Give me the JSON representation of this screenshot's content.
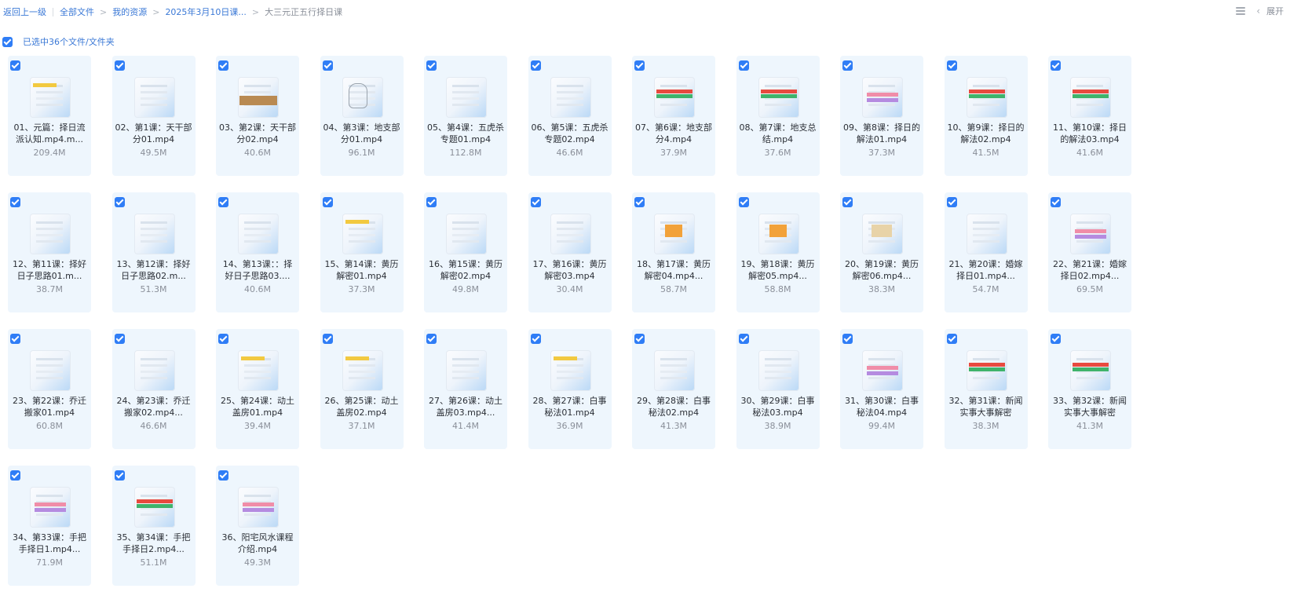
{
  "breadcrumb": {
    "back": "返回上一级",
    "all_files": "全部文件",
    "my_resources": "我的资源",
    "folder": "2025年3月10日课...",
    "current": "大三元正五行择日课"
  },
  "toolbar": {
    "expand": "展开"
  },
  "selection": {
    "text": "已选中36个文件/文件夹"
  },
  "colors": {
    "accent": "#2f7df6",
    "link": "#3a78d6",
    "card_bg": "#eef6fd"
  },
  "files": [
    {
      "name": "01、元篇：择日流派认知.mp4.m...",
      "size": "209.4M",
      "thumb": "yel"
    },
    {
      "name": "02、第1课：天干部分01.mp4",
      "size": "49.5M",
      "thumb": ""
    },
    {
      "name": "03、第2课：天干部分02.mp4",
      "size": "40.6M",
      "thumb": "tan"
    },
    {
      "name": "04、第3课：地支部分01.mp4",
      "size": "96.1M",
      "thumb": "hand"
    },
    {
      "name": "05、第4课：五虎杀专题01.mp4",
      "size": "112.8M",
      "thumb": ""
    },
    {
      "name": "06、第5课：五虎杀专题02.mp4",
      "size": "46.6M",
      "thumb": ""
    },
    {
      "name": "07、第6课：地支部分4.mp4",
      "size": "37.9M",
      "thumb": "band"
    },
    {
      "name": "08、第7课：地支总结.mp4",
      "size": "37.6M",
      "thumb": "band"
    },
    {
      "name": "09、第8课：择日的解法01.mp4",
      "size": "37.3M",
      "thumb": "pink"
    },
    {
      "name": "10、第9课：择日的解法02.mp4",
      "size": "41.5M",
      "thumb": "band"
    },
    {
      "name": "11、第10课：择日的解法03.mp4",
      "size": "41.6M",
      "thumb": "band"
    },
    {
      "name": "12、第11课：择好日子思路01.m...",
      "size": "38.7M",
      "thumb": ""
    },
    {
      "name": "13、第12课：择好日子思路02.m...",
      "size": "51.3M",
      "thumb": ""
    },
    {
      "name": "14、第13课：：择好日子思路03....",
      "size": "40.6M",
      "thumb": ""
    },
    {
      "name": "15、第14课：黄历解密01.mp4",
      "size": "37.3M",
      "thumb": "yel"
    },
    {
      "name": "16、第15课：黄历解密02.mp4",
      "size": "49.8M",
      "thumb": ""
    },
    {
      "name": "17、第16课：黄历解密03.mp4",
      "size": "30.4M",
      "thumb": ""
    },
    {
      "name": "18、第17课：黄历解密04.mp4...",
      "size": "58.7M",
      "thumb": "num"
    },
    {
      "name": "19、第18课：黄历解密05.mp4...",
      "size": "58.8M",
      "thumb": "num"
    },
    {
      "name": "20、第19课：黄历解密06.mp4...",
      "size": "38.3M",
      "thumb": "num24"
    },
    {
      "name": "21、第20课：婚嫁择日01.mp4...",
      "size": "54.7M",
      "thumb": ""
    },
    {
      "name": "22、第21课：婚嫁择日02.mp4...",
      "size": "69.5M",
      "thumb": "pink"
    },
    {
      "name": "23、第22课：乔迁搬家01.mp4",
      "size": "60.8M",
      "thumb": ""
    },
    {
      "name": "24、第23课：乔迁搬家02.mp4...",
      "size": "46.6M",
      "thumb": ""
    },
    {
      "name": "25、第24课：动土盖房01.mp4",
      "size": "39.4M",
      "thumb": "yel"
    },
    {
      "name": "26、第25课：动土盖房02.mp4",
      "size": "37.1M",
      "thumb": "yel"
    },
    {
      "name": "27、第26课：动土盖房03.mp4...",
      "size": "41.4M",
      "thumb": ""
    },
    {
      "name": "28、第27课：白事秘法01.mp4",
      "size": "36.9M",
      "thumb": "yel"
    },
    {
      "name": "29、第28课：白事秘法02.mp4",
      "size": "41.3M",
      "thumb": ""
    },
    {
      "name": "30、第29课：白事秘法03.mp4",
      "size": "38.9M",
      "thumb": ""
    },
    {
      "name": "31、第30课：白事秘法04.mp4",
      "size": "99.4M",
      "thumb": "pink"
    },
    {
      "name": "32、第31课：新闻实事大事解密",
      "size": "38.3M",
      "thumb": "band"
    },
    {
      "name": "33、第32课：新闻实事大事解密",
      "size": "41.3M",
      "thumb": "band"
    },
    {
      "name": "34、第33课：手把手择日1.mp4...",
      "size": "71.9M",
      "thumb": "pink"
    },
    {
      "name": "35、第34课：手把手择日2.mp4...",
      "size": "51.1M",
      "thumb": "band"
    },
    {
      "name": "36、阳宅风水课程介绍.mp4",
      "size": "49.3M",
      "thumb": "pink"
    }
  ]
}
